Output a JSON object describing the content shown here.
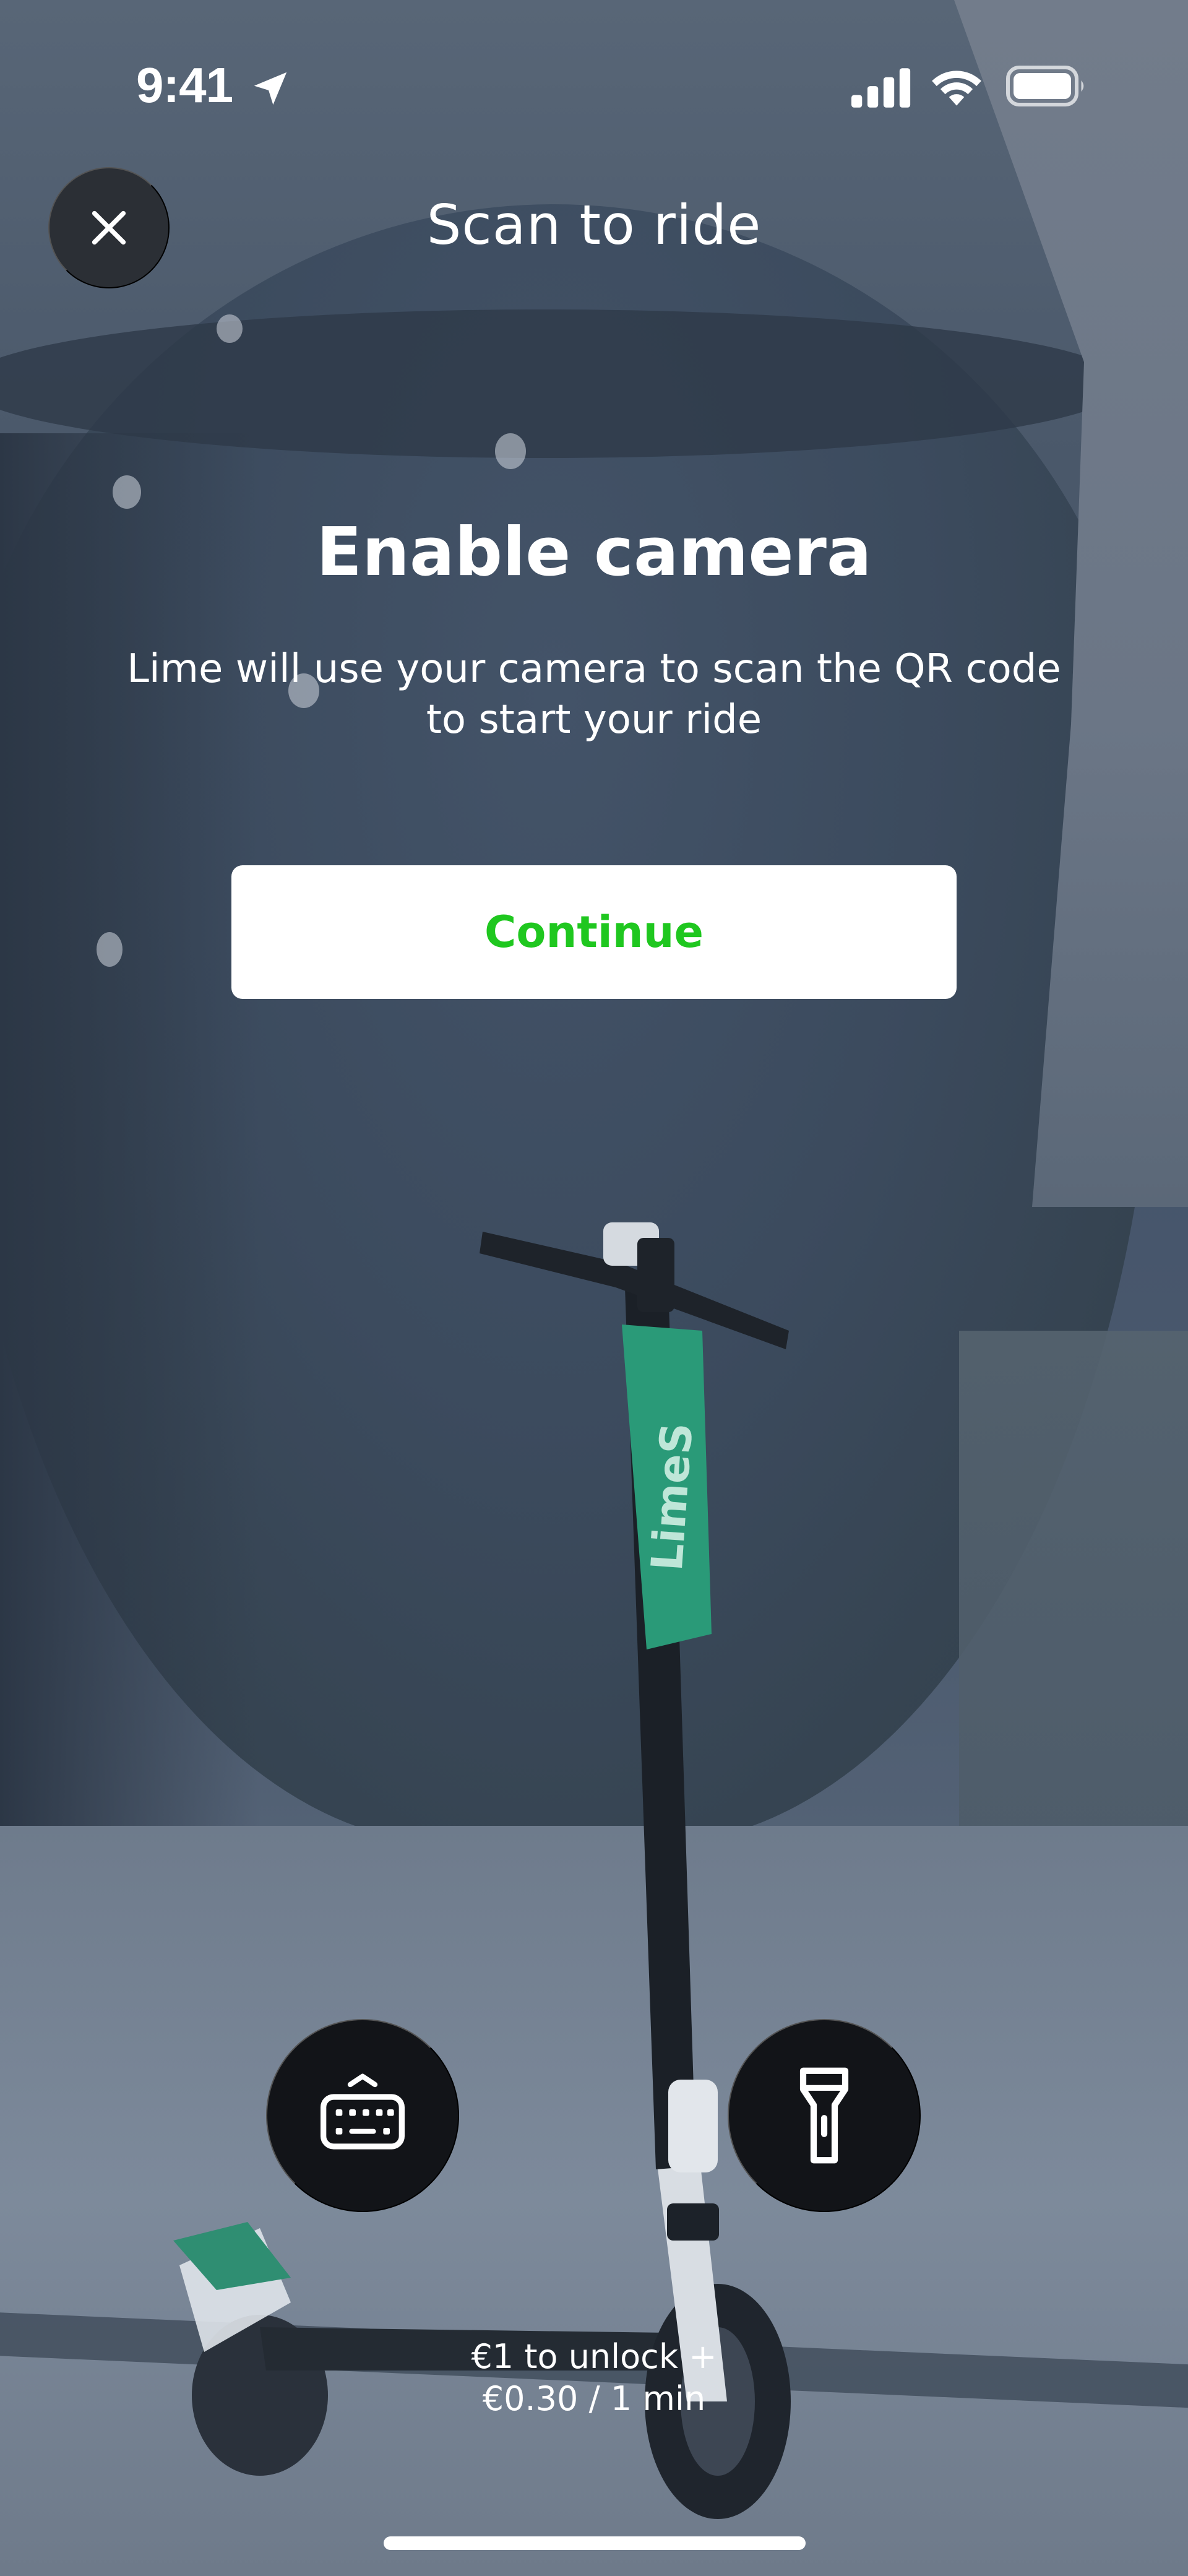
{
  "status_bar": {
    "time": "9:41",
    "icons": [
      "location-arrow-icon",
      "cellular-signal-icon",
      "wifi-icon",
      "battery-icon"
    ]
  },
  "header": {
    "title": "Scan to ride",
    "close_icon": "close-icon"
  },
  "prompt": {
    "title": "Enable camera",
    "body": "Lime will use your camera to scan the QR code to start your ride",
    "continue_label": "Continue"
  },
  "controls": {
    "keyboard_icon": "keyboard-icon",
    "flashlight_icon": "flashlight-icon"
  },
  "pricing": {
    "line1": "€1 to unlock +",
    "line2": "€0.30 / 1 min"
  },
  "scooter_brand": "LimeS",
  "colors": {
    "accent_green": "#1fc71f",
    "button_dark": "#121418",
    "overlay": "#44536a",
    "scooter_green": "#2a9a78"
  }
}
